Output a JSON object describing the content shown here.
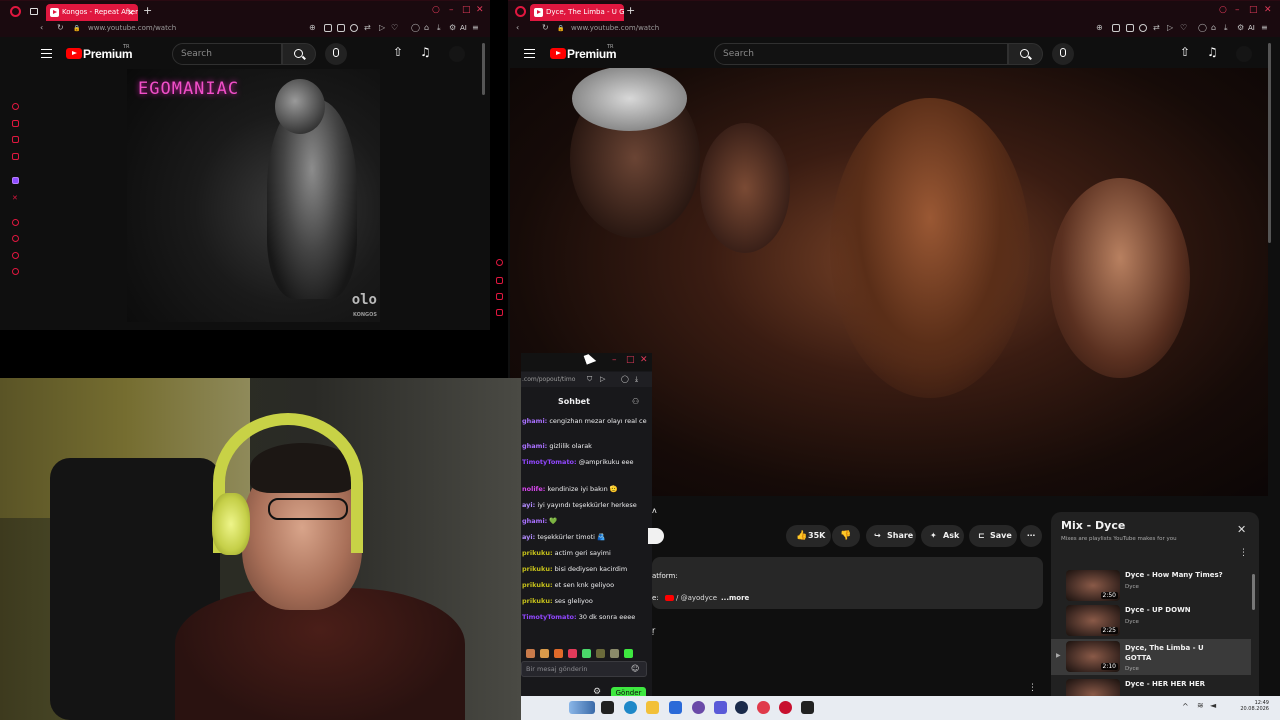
{
  "left_browser": {
    "tab_title": "Kongos - Repeat After Me",
    "url": "www.youtube.com/watch",
    "ai_label": "AI"
  },
  "right_browser": {
    "tab_title": "Dyce, The Limba - U G",
    "url": "www.youtube.com/watch"
  },
  "youtube": {
    "logo": "Premium",
    "logo_badge": "TR",
    "search_placeholder": "Search"
  },
  "album": {
    "title": "EGOMANIAC",
    "logo": "olo",
    "artist": "KONGOS"
  },
  "chat": {
    "url": ".com/popout/timo",
    "title": "Sohbet",
    "messages": [
      {
        "user": "ghami:",
        "text": "cengizhan mezar olayı real ce",
        "color": "#a970ff"
      },
      {
        "user": "ghami:",
        "text": "gizlilik olarak",
        "color": "#a970ff"
      },
      {
        "user": "TimotyTomato:",
        "text": "@amprikuku eee",
        "color": "#9147ff"
      },
      {
        "user": "nolife:",
        "text": "kendinize iyi bakın 🫡",
        "color": "#d946ef"
      },
      {
        "user": "ayi:",
        "text": "iyi yayındı teşekkürler herkese",
        "color": "#b28cff"
      },
      {
        "user": "ghami:",
        "text": "💚",
        "color": "#a970ff"
      },
      {
        "user": "ayi:",
        "text": "teşekkürler timoti 🫂",
        "color": "#b28cff"
      },
      {
        "user": "prikuku:",
        "text": "actim geri sayimi",
        "color": "#c7c21b"
      },
      {
        "user": "prikuku:",
        "text": "bisi dediysen kacirdim",
        "color": "#c7c21b"
      },
      {
        "user": "prikuku:",
        "text": "et sen knk geliyoo",
        "color": "#c7c21b"
      },
      {
        "user": "prikuku:",
        "text": "ses gleliyoo",
        "color": "#c7c21b"
      },
      {
        "user": "TimotyTomato:",
        "text": "30 dk sonra eeee",
        "color": "#9147ff"
      }
    ],
    "input_placeholder": "Bir mesaj gönderin",
    "send_label": "Gönder"
  },
  "video_actions": {
    "likes": "35K",
    "share": "Share",
    "ask": "Ask",
    "save": "Save"
  },
  "description": {
    "line1": "atform:",
    "handle": "/ @ayodyce",
    "more": "...more"
  },
  "mix": {
    "title": "Mix - Dyce",
    "subtitle": "Mixes are playlists YouTube makes for you",
    "items": [
      {
        "title": "Dyce - How Many Times?",
        "channel": "Dyce",
        "duration": "2:50"
      },
      {
        "title": "Dyce - UP DOWN",
        "channel": "Dyce",
        "duration": "2:25"
      },
      {
        "title": "Dyce, The Limba - U GOTTA",
        "channel": "Dyce",
        "duration": "2:10"
      },
      {
        "title": "Dyce - HER HER HER",
        "channel": "",
        "duration": ""
      }
    ]
  },
  "taskbar": {
    "time": "12:49",
    "date": "20.08.2026"
  },
  "colors": {
    "accent": "#e0173f",
    "yt_red": "#ff0000",
    "twitch_green": "#3ee840"
  }
}
